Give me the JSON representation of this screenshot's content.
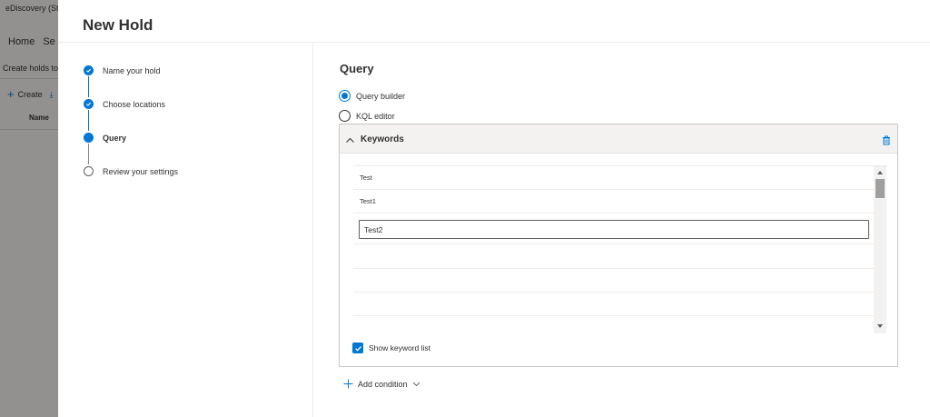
{
  "background": {
    "app_title": "eDiscovery (Sta",
    "nav": [
      "Home",
      "Se"
    ],
    "description": "Create holds to",
    "toolbar": {
      "create_label": "Create"
    },
    "column_name": "Name"
  },
  "panel": {
    "title": "New Hold",
    "steps": [
      {
        "label": "Name your hold",
        "status": "completed"
      },
      {
        "label": "Choose locations",
        "status": "completed"
      },
      {
        "label": "Query",
        "status": "current"
      },
      {
        "label": "Review your settings",
        "status": "pending"
      }
    ],
    "query": {
      "section_title": "Query",
      "options": [
        {
          "label": "Query builder",
          "selected": true
        },
        {
          "label": "KQL editor",
          "selected": false
        }
      ],
      "keywords": {
        "title": "Keywords",
        "items": [
          "Test",
          "Test1"
        ],
        "input_value": "Test2",
        "show_keyword_list": {
          "label": "Show keyword list",
          "checked": true
        }
      },
      "add_condition_label": "Add condition"
    }
  },
  "colors": {
    "accent": "#0078d4",
    "text": "#323130",
    "border": "#c8c6c4"
  }
}
